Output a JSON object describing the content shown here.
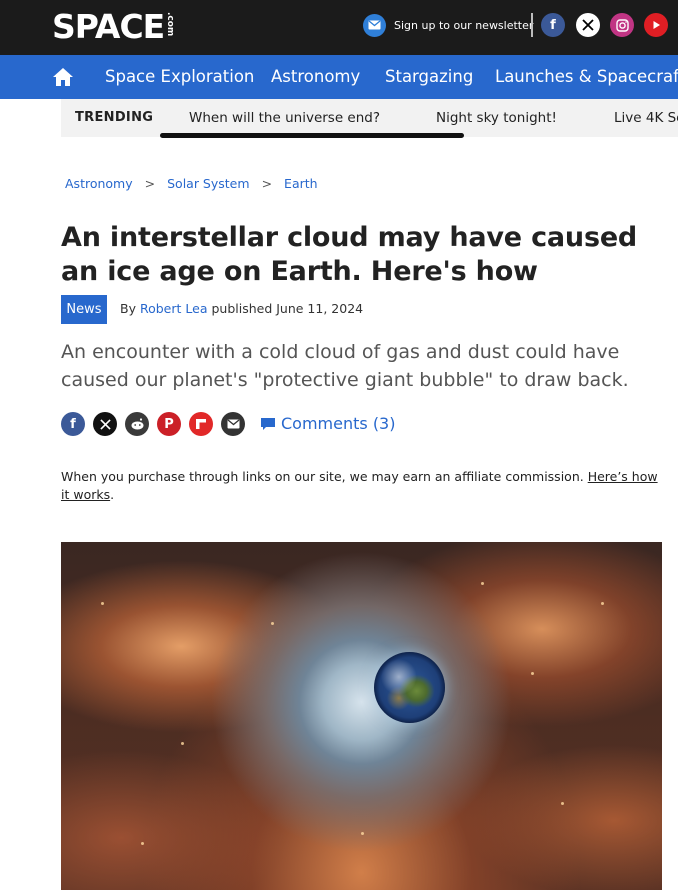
{
  "header": {
    "logo": "SPACE",
    "logo_suffix": ".com",
    "newsletter_label": "Sign up to our newsletter",
    "social": [
      "facebook-icon",
      "x-icon",
      "instagram-icon",
      "youtube-icon"
    ]
  },
  "nav": {
    "items": [
      "Space Exploration",
      "Astronomy",
      "Stargazing",
      "Launches & Spacecraft"
    ]
  },
  "trending": {
    "label": "TRENDING",
    "items": [
      "When will the universe end?",
      "Night sky tonight!",
      "Live 4K Se"
    ]
  },
  "breadcrumb": [
    "Astronomy",
    "Solar System",
    "Earth"
  ],
  "article": {
    "title": "An interstellar cloud may have caused an ice age on Earth. Here's how",
    "badge": "News",
    "by": "By",
    "author": "Robert Lea",
    "published": "published June 11, 2024",
    "subtitle": "An encounter with a cold cloud of gas and dust could have caused our planet's \"protective giant bubble\" to draw back.",
    "comments": "Comments (3)",
    "affiliate_text": "When you purchase through links on our site, we may earn an affiliate commission. ",
    "affiliate_link": "Here’s how it works",
    "affiliate_end": "."
  },
  "colors": {
    "brand_blue": "#2868cd",
    "topbar": "#1b1b1b"
  }
}
